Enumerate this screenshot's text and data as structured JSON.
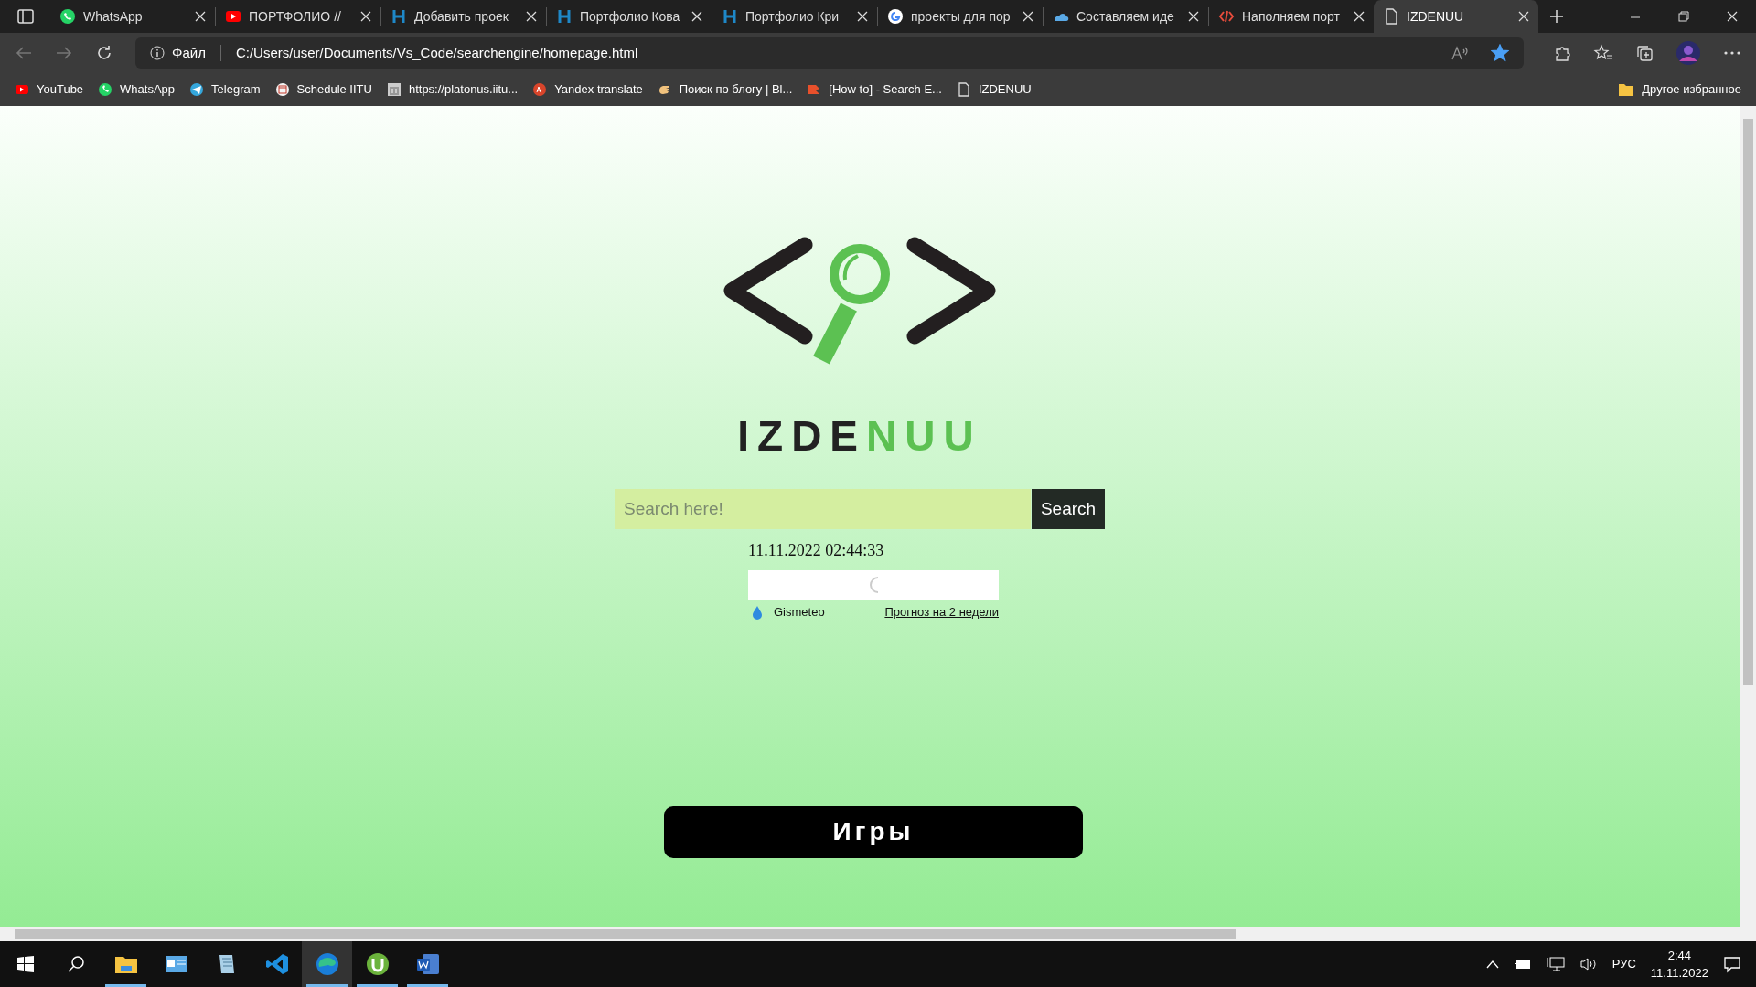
{
  "tabs": [
    {
      "title": "WhatsApp",
      "selected": false
    },
    {
      "title": "ПОРТФОЛИО //",
      "selected": false
    },
    {
      "title": "Добавить проек",
      "selected": false
    },
    {
      "title": "Портфолио Кова",
      "selected": false
    },
    {
      "title": "Портфолио Кри",
      "selected": false
    },
    {
      "title": "проекты для пор",
      "selected": false
    },
    {
      "title": "Составляем иде",
      "selected": false
    },
    {
      "title": "Наполняем порт",
      "selected": false
    },
    {
      "title": "IZDENUU",
      "selected": true
    }
  ],
  "address_bar": {
    "scheme_label": "Файл",
    "url": "C:/Users/user/Documents/Vs_Code/searchengine/homepage.html",
    "favorite": true
  },
  "bookmarks": [
    {
      "label": "YouTube"
    },
    {
      "label": "WhatsApp"
    },
    {
      "label": "Telegram"
    },
    {
      "label": "Schedule IITU"
    },
    {
      "label": "https://platonus.iitu..."
    },
    {
      "label": "Yandex translate"
    },
    {
      "label": "Поиск по блогу | Bl..."
    },
    {
      "label": "[How to] - Search E..."
    },
    {
      "label": "IZDENUU"
    }
  ],
  "other_bookmarks": "Другое избранное",
  "page": {
    "brand": {
      "dark": "IZDE",
      "accent": "NUU"
    },
    "search": {
      "placeholder": "Search here!",
      "button": "Search"
    },
    "datetime": "11.11.2022 02:44:33",
    "weather": {
      "provider": "Gismeteo",
      "link": "Прогноз на 2 недели"
    },
    "games_button": "Игры"
  },
  "taskbar": {
    "apps": [
      {
        "running": true,
        "selected": false
      },
      {
        "running": false,
        "selected": false
      },
      {
        "running": false,
        "selected": false
      },
      {
        "running": false,
        "selected": false
      },
      {
        "running": true,
        "selected": true
      },
      {
        "running": true,
        "selected": false
      },
      {
        "running": true,
        "selected": false
      }
    ],
    "language": "РУС",
    "time": "2:44",
    "date": "11.11.2022"
  }
}
